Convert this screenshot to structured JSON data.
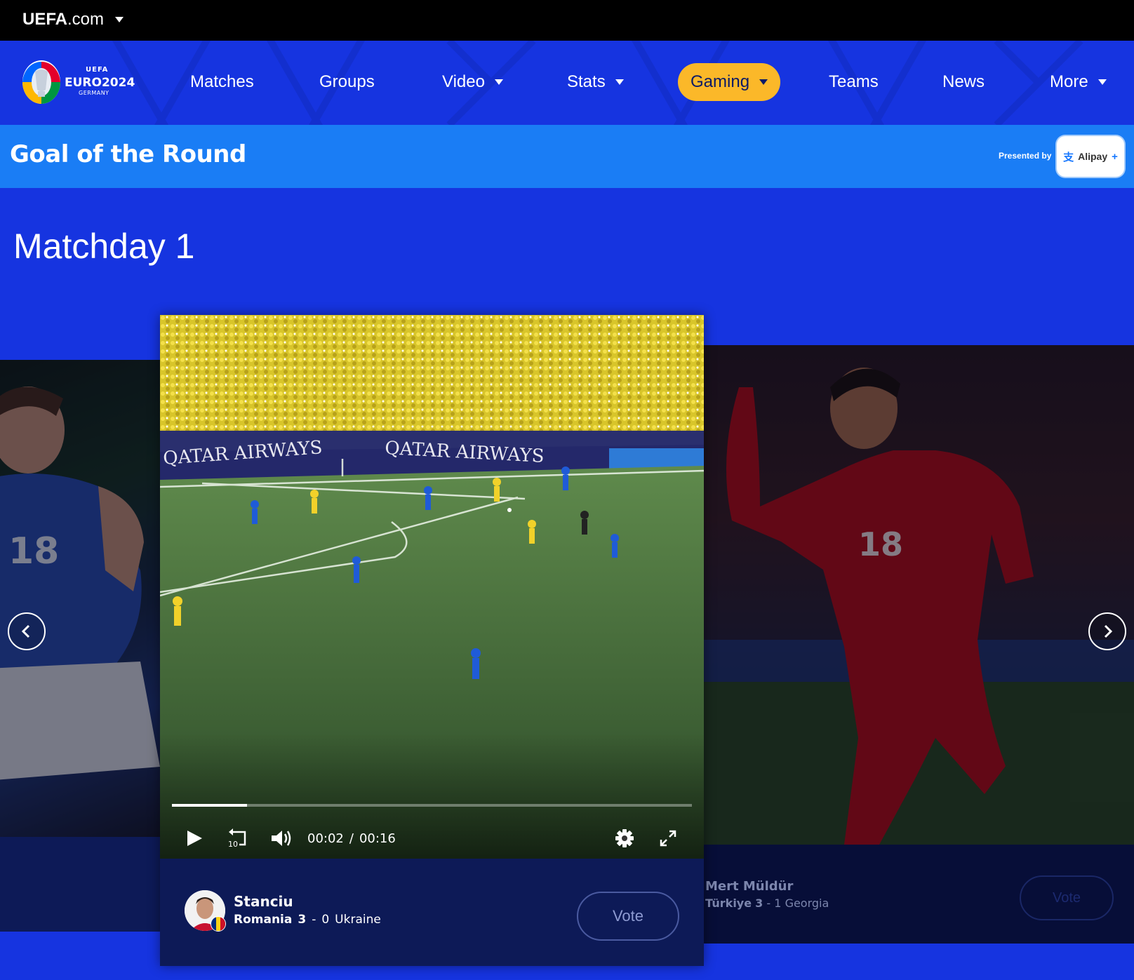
{
  "topbar": {
    "brand_bold": "UEFA",
    "brand_rest": ".com"
  },
  "logo": {
    "uefa": "UEFA",
    "euro": "EURO2024",
    "country": "GERMANY"
  },
  "nav": {
    "items": [
      {
        "label": "Matches",
        "dropdown": false
      },
      {
        "label": "Groups",
        "dropdown": false
      },
      {
        "label": "Video",
        "dropdown": true
      },
      {
        "label": "Stats",
        "dropdown": true
      },
      {
        "label": "Gaming",
        "dropdown": true,
        "active": true
      },
      {
        "label": "Teams",
        "dropdown": false
      },
      {
        "label": "News",
        "dropdown": false
      },
      {
        "label": "More",
        "dropdown": true
      }
    ]
  },
  "banner": {
    "title": "Goal of the Round",
    "presented_by": "Presented by",
    "sponsor": "Alipay",
    "sponsor_mark": "支",
    "sponsor_plus": "+"
  },
  "section": {
    "title": "Matchday 1"
  },
  "video": {
    "current_time": "00:02",
    "separator": "/",
    "duration": "00:16",
    "progress": 0.145,
    "skip_seconds": "10",
    "ad_board_1": "QATAR AIRWAYS",
    "ad_board_2": "QATAR AIRWAYS"
  },
  "center_goal": {
    "player": "Stanciu",
    "home_team": "Romania",
    "home_score": "3",
    "dash": "-",
    "away_score": "0",
    "away_team": "Ukraine",
    "vote_label": "Vote"
  },
  "right_goal": {
    "player": "Mert Müldür",
    "home_team": "Türkiye",
    "home_score": "3",
    "dash": "-",
    "away_score": "1",
    "away_team": "Georgia",
    "vote_label": "Vote"
  },
  "colors": {
    "page_bg": "#1634e0",
    "banner_bg": "#1a7df5",
    "active_nav": "#fbb829",
    "card_footer": "#0d1a57"
  },
  "icons": [
    "caret-down-icon",
    "play-icon",
    "replay-10-icon",
    "volume-icon",
    "settings-icon",
    "fullscreen-icon",
    "chevron-left-icon",
    "chevron-right-icon"
  ]
}
